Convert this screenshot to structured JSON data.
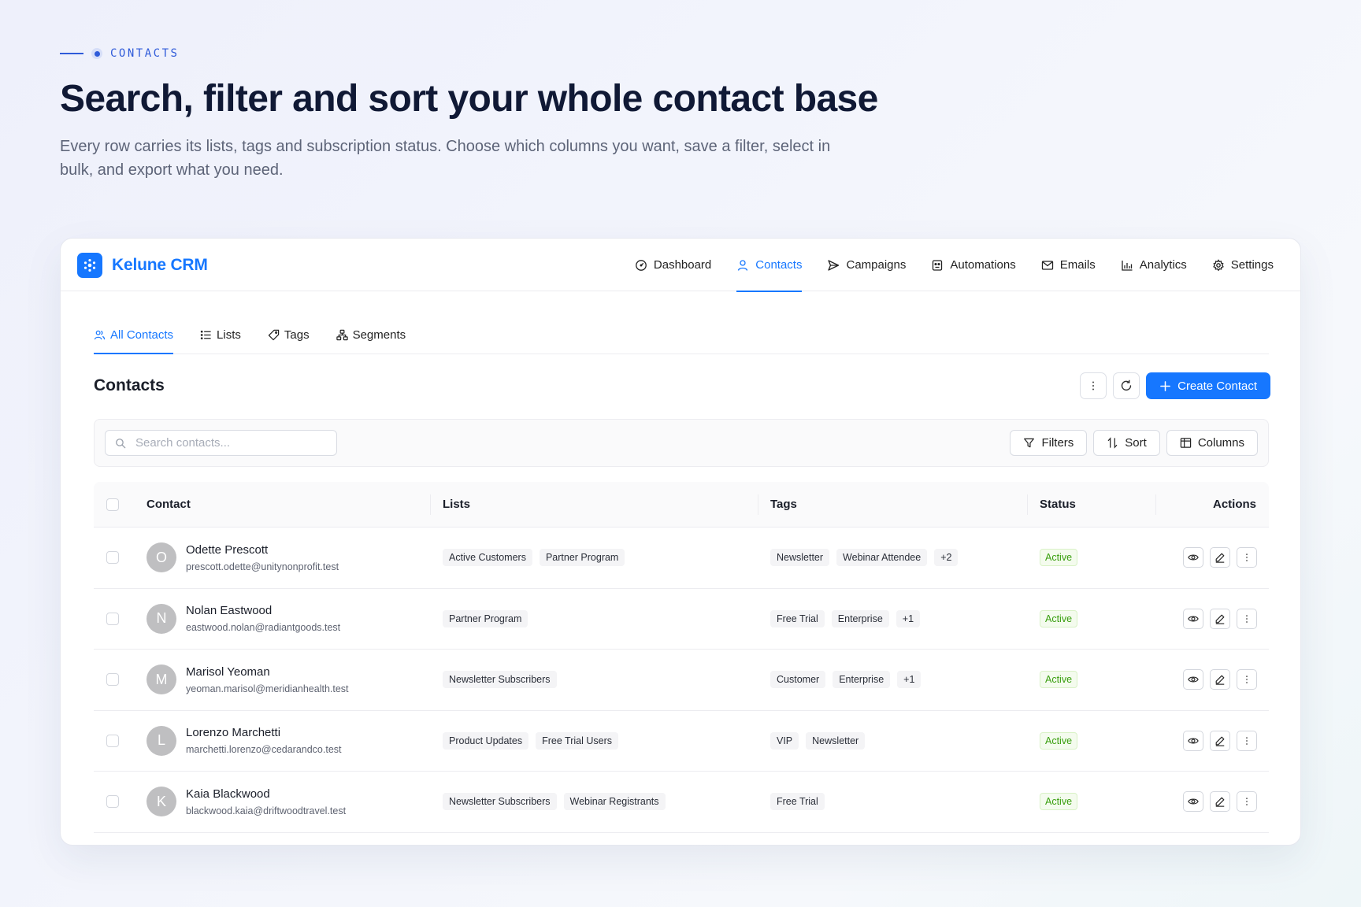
{
  "hero": {
    "eyebrow": "CONTACTS",
    "title": "Search, filter and sort your whole contact base",
    "subtitle": "Every row carries its lists, tags and subscription status. Choose which columns you want, save a filter, select in bulk, and export what you need."
  },
  "app": {
    "brand": "Kelune CRM",
    "accent": "#1677ff",
    "nav": [
      {
        "label": "Dashboard",
        "icon": "gauge-icon"
      },
      {
        "label": "Contacts",
        "icon": "user-icon",
        "active": true
      },
      {
        "label": "Campaigns",
        "icon": "send-icon"
      },
      {
        "label": "Automations",
        "icon": "robot-icon"
      },
      {
        "label": "Emails",
        "icon": "mail-icon"
      },
      {
        "label": "Analytics",
        "icon": "bar-chart-icon"
      },
      {
        "label": "Settings",
        "icon": "gear-icon"
      }
    ],
    "subtabs": [
      {
        "label": "All Contacts",
        "icon": "users-icon",
        "active": true
      },
      {
        "label": "Lists",
        "icon": "list-icon"
      },
      {
        "label": "Tags",
        "icon": "tag-icon"
      },
      {
        "label": "Segments",
        "icon": "cluster-icon"
      }
    ]
  },
  "section": {
    "title": "Contacts",
    "create_label": "Create Contact"
  },
  "toolbar": {
    "search_placeholder": "Search contacts...",
    "filters_label": "Filters",
    "sort_label": "Sort",
    "columns_label": "Columns"
  },
  "table": {
    "headers": {
      "contact": "Contact",
      "lists": "Lists",
      "tags": "Tags",
      "status": "Status",
      "actions": "Actions"
    },
    "rows": [
      {
        "initial": "O",
        "name": "Odette Prescott",
        "email": "prescott.odette@unitynonprofit.test",
        "lists": [
          "Active Customers",
          "Partner Program"
        ],
        "tags": [
          "Newsletter",
          "Webinar Attendee",
          "+2"
        ],
        "status": "Active"
      },
      {
        "initial": "N",
        "name": "Nolan Eastwood",
        "email": "eastwood.nolan@radiantgoods.test",
        "lists": [
          "Partner Program"
        ],
        "tags": [
          "Free Trial",
          "Enterprise",
          "+1"
        ],
        "status": "Active"
      },
      {
        "initial": "M",
        "name": "Marisol Yeoman",
        "email": "yeoman.marisol@meridianhealth.test",
        "lists": [
          "Newsletter Subscribers"
        ],
        "tags": [
          "Customer",
          "Enterprise",
          "+1"
        ],
        "status": "Active"
      },
      {
        "initial": "L",
        "name": "Lorenzo Marchetti",
        "email": "marchetti.lorenzo@cedarandco.test",
        "lists": [
          "Product Updates",
          "Free Trial Users"
        ],
        "tags": [
          "VIP",
          "Newsletter"
        ],
        "status": "Active"
      },
      {
        "initial": "K",
        "name": "Kaia Blackwood",
        "email": "blackwood.kaia@driftwoodtravel.test",
        "lists": [
          "Newsletter Subscribers",
          "Webinar Registrants"
        ],
        "tags": [
          "Free Trial"
        ],
        "status": "Active"
      }
    ]
  }
}
